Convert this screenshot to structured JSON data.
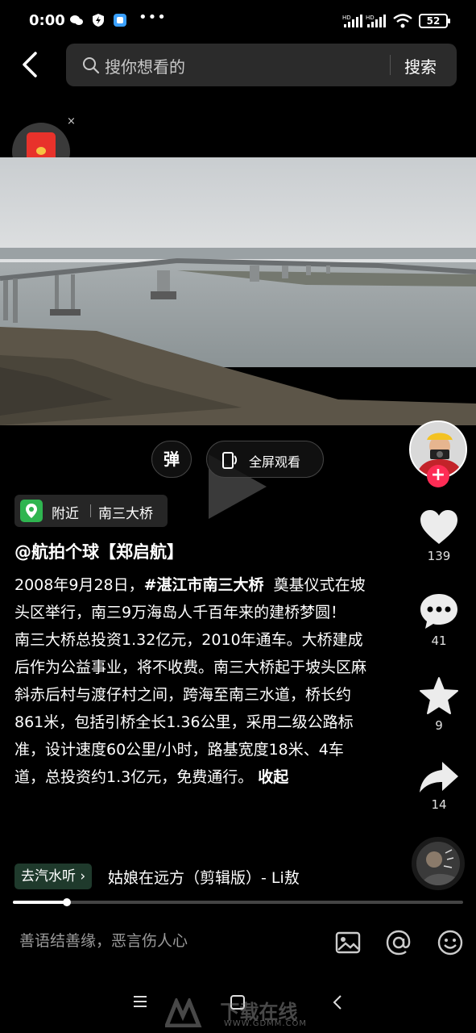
{
  "status_bar": {
    "time": "0:00",
    "dots": "•••",
    "battery": "52"
  },
  "search": {
    "placeholder": "搜你想看的",
    "submit_label": "搜索"
  },
  "redpack": {
    "close": "×"
  },
  "video_controls": {
    "danmaku_label": "弹",
    "fullscreen_label": "全屏观看"
  },
  "location": {
    "nearby_label": "附近",
    "place": "南三大桥"
  },
  "post": {
    "author": "@航拍个球【郑启航】",
    "desc_line1_prefix": "2008年9月28日，",
    "hashtag": "#湛江市南三大桥",
    "desc_line1_suffix": "  奠基仪式在坡头区举行，南三9万海岛人千百年来的建桥梦圆！\n南三大桥总投资1.32亿元，2010年通车。大桥建成后作为公益事业，将不收费。南三大桥起于坡头区麻斜赤后村与渡仔村之间，跨海至南三水道，桥长约861米，包括引桥全长1.36公里，采用二级公路标准，设计速度60公里/小时，路基宽度18米、4车道，总投资约1.3亿元，免费通行。 ",
    "collapse_label": "收起"
  },
  "actions": {
    "likes": "139",
    "comments": "41",
    "favorites": "9",
    "shares": "14"
  },
  "music": {
    "chip_label": "去汽水听 ›",
    "title": "姑娘在远方（剪辑版）- Li敖"
  },
  "progress": {
    "fraction": 0.12
  },
  "comment_bar": {
    "placeholder": "善语结善缘，恶言伤人心"
  },
  "watermark": {
    "brand": "下载在线",
    "url": "WWW.GDMM.COM"
  },
  "colors": {
    "background": "#000000",
    "follow": "#fe2c55",
    "location_icon": "#2fb550"
  }
}
